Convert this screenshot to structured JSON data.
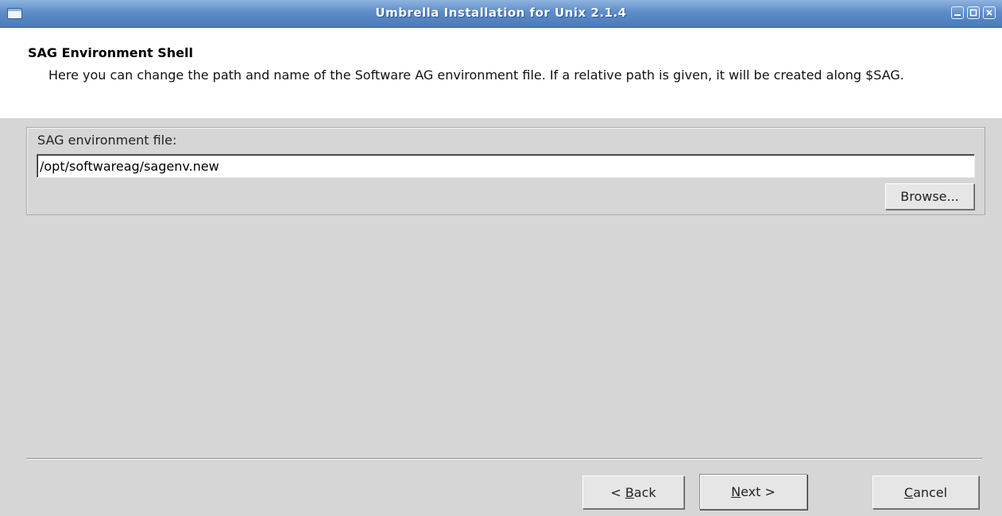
{
  "window": {
    "title": "Umbrella Installation for Unix 2.1.4",
    "icons": [
      "window-menu-icon",
      "minimize-icon",
      "maximize-icon",
      "close-icon"
    ]
  },
  "header": {
    "title": "SAG Environment Shell",
    "description": "Here you can change the path and name of the Software AG environment file. If a relative path is given, it will be created along $SAG."
  },
  "form": {
    "group_label": "SAG environment file:",
    "path_value": "/opt/softwareag/sagenv.new",
    "browse_label": "Browse..."
  },
  "buttons": {
    "back_prefix": "< ",
    "back_mnemonic": "B",
    "back_rest": "ack",
    "next_mnemonic": "N",
    "next_rest": "ext >",
    "cancel_mnemonic": "C",
    "cancel_rest": "ancel"
  },
  "colors": {
    "titlebar": "#5d8cc9",
    "background": "#d6d6d6",
    "header_background": "#ffffff"
  }
}
